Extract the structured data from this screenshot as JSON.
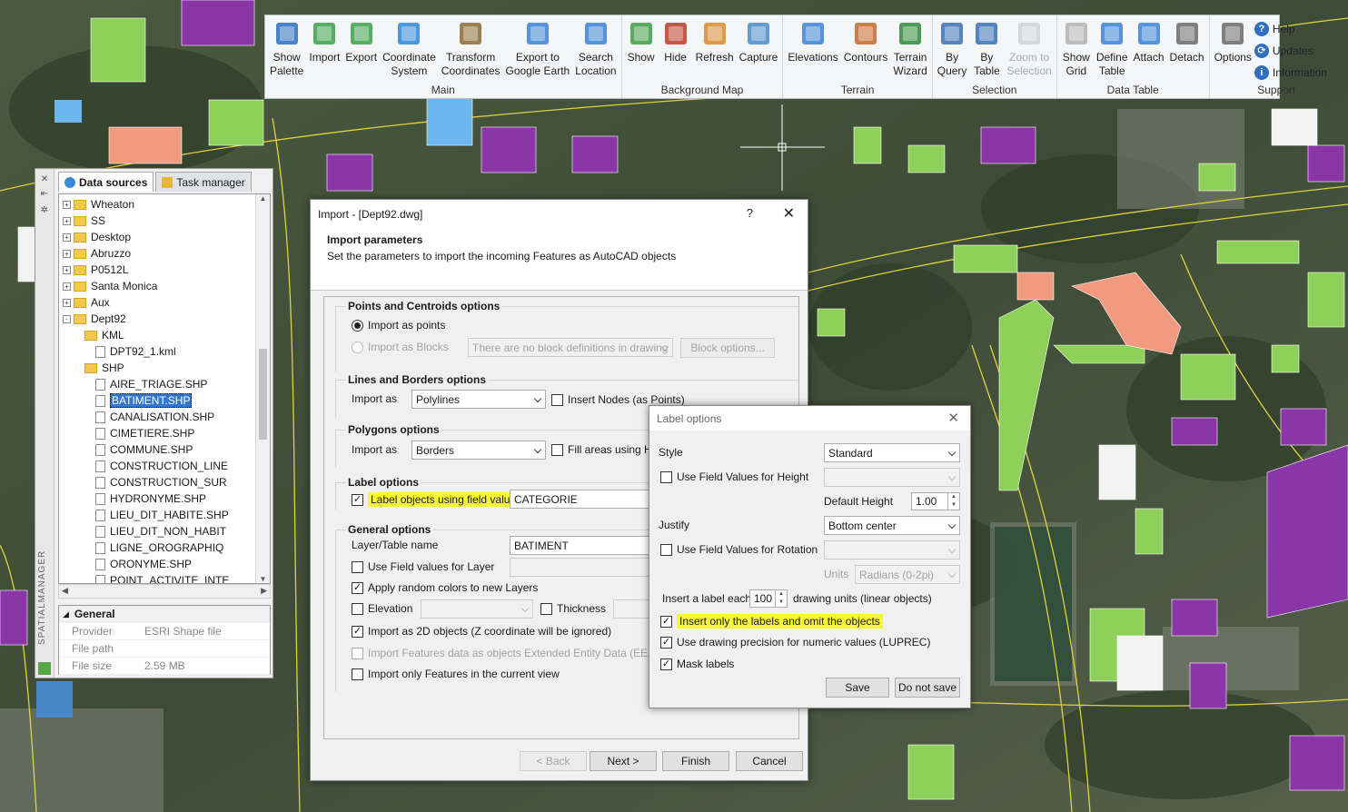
{
  "ribbon": {
    "groups": [
      {
        "title": "Main",
        "buttons": [
          {
            "label": "Show\nPalette",
            "icon": "spm-palette-icon"
          },
          {
            "label": "Import",
            "icon": "import-icon"
          },
          {
            "label": "Export",
            "icon": "export-icon"
          },
          {
            "label": "Coordinate\nSystem",
            "icon": "globe-icon"
          },
          {
            "label": "Transform\nCoordinates",
            "icon": "transform-globe-icon"
          },
          {
            "label": "Export to\nGoogle Earth",
            "icon": "google-earth-icon"
          },
          {
            "label": "Search\nLocation",
            "icon": "map-pin-icon"
          }
        ]
      },
      {
        "title": "Background Map",
        "buttons": [
          {
            "label": "Show",
            "icon": "map-show-icon"
          },
          {
            "label": "Hide",
            "icon": "map-hide-icon"
          },
          {
            "label": "Refresh",
            "icon": "map-refresh-icon"
          },
          {
            "label": "Capture",
            "icon": "map-capture-icon"
          }
        ]
      },
      {
        "title": "Terrain",
        "buttons": [
          {
            "label": "Elevations",
            "icon": "elevations-icon"
          },
          {
            "label": "Contours",
            "icon": "contours-icon"
          },
          {
            "label": "Terrain\nWizard",
            "icon": "terrain-wizard-icon"
          }
        ]
      },
      {
        "title": "Selection",
        "buttons": [
          {
            "label": "By\nQuery",
            "icon": "select-by-query-icon"
          },
          {
            "label": "By\nTable",
            "icon": "select-by-table-icon"
          },
          {
            "label": "Zoom to\nSelection",
            "icon": "zoom-selection-icon",
            "disabled": true
          }
        ]
      },
      {
        "title": "Data Table",
        "buttons": [
          {
            "label": "Show\nGrid",
            "icon": "grid-icon"
          },
          {
            "label": "Define\nTable",
            "icon": "define-table-icon"
          },
          {
            "label": "Attach",
            "icon": "attach-icon"
          },
          {
            "label": "Detach",
            "icon": "detach-icon"
          }
        ]
      },
      {
        "title": "Support",
        "buttons": [
          {
            "label": "Options",
            "icon": "options-tools-icon"
          }
        ],
        "list": [
          {
            "label": "Help",
            "icon": "help-icon"
          },
          {
            "label": "Updates",
            "icon": "updates-icon"
          },
          {
            "label": "Information",
            "icon": "information-icon"
          }
        ]
      }
    ]
  },
  "palette": {
    "vertical_title": "SPATIALMANAGER",
    "tabs": [
      {
        "label": "Data sources",
        "active": true
      },
      {
        "label": "Task manager",
        "active": false
      }
    ],
    "tree": [
      {
        "label": "Wheaton",
        "level": 0,
        "type": "folder",
        "expander": "+"
      },
      {
        "label": "SS",
        "level": 0,
        "type": "folder",
        "expander": "+"
      },
      {
        "label": "Desktop",
        "level": 0,
        "type": "folder",
        "expander": "+"
      },
      {
        "label": "Abruzzo",
        "level": 0,
        "type": "folder",
        "expander": "+"
      },
      {
        "label": "P0512L",
        "level": 0,
        "type": "folder",
        "expander": "+"
      },
      {
        "label": "Santa Monica",
        "level": 0,
        "type": "folder",
        "expander": "+"
      },
      {
        "label": "Aux",
        "level": 0,
        "type": "folder",
        "expander": "+"
      },
      {
        "label": "Dept92",
        "level": 0,
        "type": "folder",
        "expander": "-"
      },
      {
        "label": "KML",
        "level": 1,
        "type": "folder",
        "expander": ""
      },
      {
        "label": "DPT92_1.kml",
        "level": 2,
        "type": "file",
        "expander": ""
      },
      {
        "label": "SHP",
        "level": 1,
        "type": "folder",
        "expander": ""
      },
      {
        "label": "AIRE_TRIAGE.SHP",
        "level": 2,
        "type": "file",
        "expander": ""
      },
      {
        "label": "BATIMENT.SHP",
        "level": 2,
        "type": "file",
        "expander": "",
        "selected": true
      },
      {
        "label": "CANALISATION.SHP",
        "level": 2,
        "type": "file",
        "expander": ""
      },
      {
        "label": "CIMETIERE.SHP",
        "level": 2,
        "type": "file",
        "expander": ""
      },
      {
        "label": "COMMUNE.SHP",
        "level": 2,
        "type": "file",
        "expander": ""
      },
      {
        "label": "CONSTRUCTION_LINE",
        "level": 2,
        "type": "file",
        "expander": ""
      },
      {
        "label": "CONSTRUCTION_SUR",
        "level": 2,
        "type": "file",
        "expander": ""
      },
      {
        "label": "HYDRONYME.SHP",
        "level": 2,
        "type": "file",
        "expander": ""
      },
      {
        "label": "LIEU_DIT_HABITE.SHP",
        "level": 2,
        "type": "file",
        "expander": ""
      },
      {
        "label": "LIEU_DIT_NON_HABIT",
        "level": 2,
        "type": "file",
        "expander": ""
      },
      {
        "label": "LIGNE_OROGRAPHIQ",
        "level": 2,
        "type": "file",
        "expander": ""
      },
      {
        "label": "ORONYME.SHP",
        "level": 2,
        "type": "file",
        "expander": ""
      },
      {
        "label": "POINT_ACTIVITE_INTE",
        "level": 2,
        "type": "file",
        "expander": ""
      }
    ],
    "props": {
      "section": "General",
      "rows": [
        {
          "key": "Provider",
          "value": "ESRI Shape file"
        },
        {
          "key": "File path",
          "value": ""
        },
        {
          "key": "File size",
          "value": "2.59 MB"
        }
      ]
    }
  },
  "import_dialog": {
    "title": "Import - [Dept92.dwg]",
    "help": "?",
    "close": "✕",
    "header_title": "Import parameters",
    "header_desc": "Set the parameters to import the incoming Features as AutoCAD objects",
    "points": {
      "title": "Points and Centroids options",
      "as_points": "Import as points",
      "as_blocks": "Import as Blocks",
      "blocks_combo": "There are no block definitions in drawing",
      "block_options": "Block options..."
    },
    "lines": {
      "title": "Lines and Borders options",
      "import_as": "Import as",
      "value": "Polylines",
      "insert_nodes": "Insert Nodes (as Points)"
    },
    "polygons": {
      "title": "Polygons options",
      "import_as": "Import as",
      "value": "Borders",
      "fill_areas": "Fill areas using Ha"
    },
    "label": {
      "title": "Label options",
      "label_objects": "Label objects using field value",
      "field": "CATEGORIE"
    },
    "general": {
      "title": "General options",
      "layer_name": "Layer/Table name",
      "layer_value": "BATIMENT",
      "use_field_layer": "Use Field values for Layer",
      "random_colors": "Apply random colors to new Layers",
      "elevation": "Elevation",
      "thickness": "Thickness",
      "as_2d": "Import as 2D objects (Z coordinate will be ignored)",
      "eed": "Import Features data as objects Extended Entity Data (EED)",
      "current_view": "Import only Features in the current view"
    },
    "buttons": {
      "back": "< Back",
      "next": "Next >",
      "finish": "Finish",
      "cancel": "Cancel"
    }
  },
  "label_dialog": {
    "title": "Label options",
    "close": "✕",
    "style_label": "Style",
    "style_value": "Standard",
    "use_height": "Use Field Values for Height",
    "default_height_label": "Default Height",
    "default_height": "1.00",
    "justify_label": "Justify",
    "justify_value": "Bottom center",
    "use_rotation": "Use Field Values for Rotation",
    "units_label": "Units",
    "units_value": "Radians (0-2pi)",
    "insert_each": "Insert a label each",
    "insert_value": "100",
    "drawing_units": "drawing units (linear objects)",
    "omit_objects": "Insert only the labels and omit the objects",
    "precision": "Use drawing precision for numeric values (LUPREC)",
    "mask": "Mask labels",
    "save": "Save",
    "do_not_save": "Do not save"
  },
  "colors": {
    "highlight": "#f8f835",
    "selection": "#3176d1",
    "building_green": "#8fd05a",
    "building_purple": "#8a35a8",
    "building_salmon": "#f19a80"
  }
}
